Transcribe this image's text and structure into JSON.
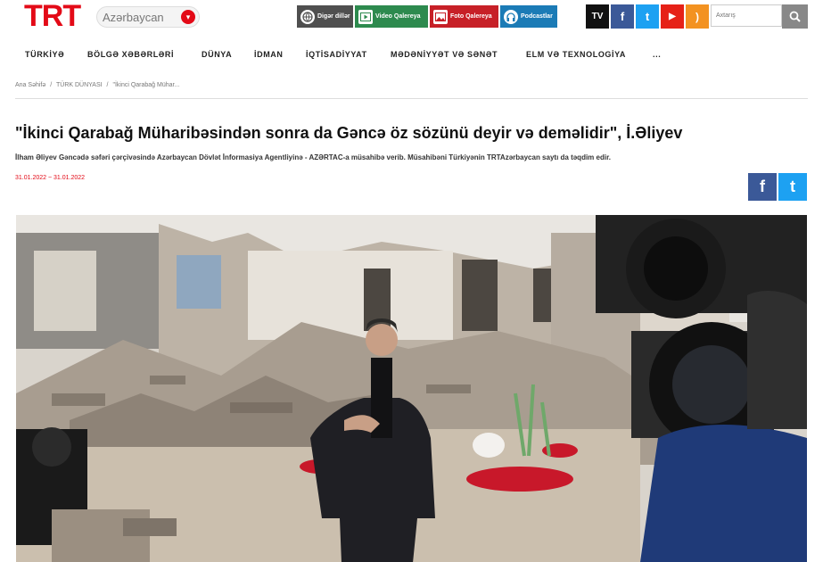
{
  "header": {
    "logo_text": "TRT",
    "region": "Azərbaycan",
    "services": [
      {
        "label": "Digər dillər",
        "icon": "globe-icon"
      },
      {
        "label": "Video Qalereya",
        "icon": "video-icon"
      },
      {
        "label": "Foto Qalereya",
        "icon": "photo-icon"
      },
      {
        "label": "Podcastlar",
        "icon": "headphones-icon"
      }
    ],
    "social": {
      "tv": "TV",
      "facebook": "f",
      "twitter": "t",
      "youtube": "▶",
      "rss": ")"
    },
    "search": {
      "placeholder": "Axtarış"
    }
  },
  "nav": {
    "items": [
      "TÜRKİYƏ",
      "BÖLGƏ XƏBƏRLƏRİ",
      "DÜNYA",
      "İDMAN",
      "İQTİSADİYYAT",
      "MƏDƏNİYYƏT VƏ SƏNƏT",
      "ELM VƏ TEXNOLOGİYA",
      "..."
    ]
  },
  "breadcrumb": {
    "items": [
      "Ana Səhifə",
      "/",
      "TÜRK DÜNYASI",
      "/",
      "\"İkinci Qarabağ Mühar..."
    ]
  },
  "article": {
    "title": "\"İkinci Qarabağ Müharibəsindən sonra da Gəncə öz sözünü deyir və deməlidir\", İ.Əliyev",
    "lead": "İlham Əliyev Gəncədə səfəri çərçivəsində Azərbaycan Dövlət İnformasiya Agentliyinə - AZƏRTAC-a müsahibə verib. Müsahibəni Türkiyənin TRTAzərbaycan saytı da təqdim edir.",
    "date": "31.01.2022 ~ 31.01.2022",
    "share": {
      "facebook": "f",
      "twitter": "t"
    }
  },
  "colors": {
    "brand_red": "#e30a17",
    "facebook": "#3b5998",
    "twitter": "#1da1f2"
  }
}
